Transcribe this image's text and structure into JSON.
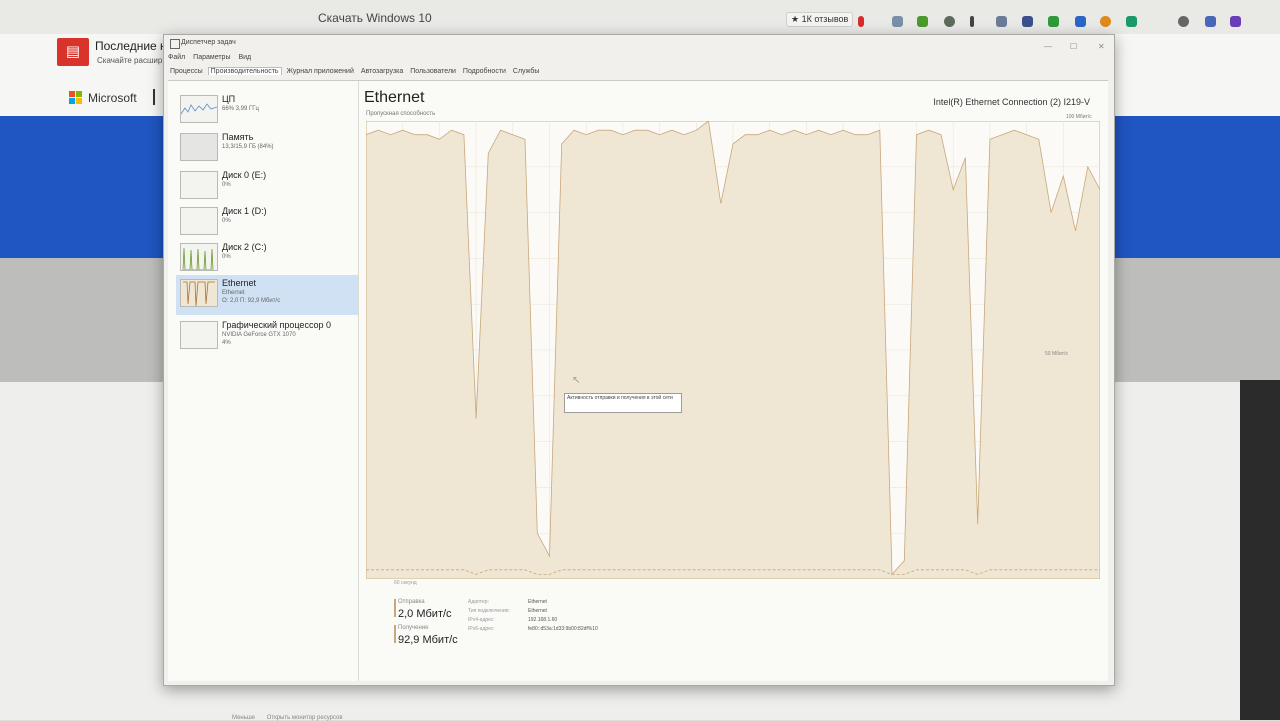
{
  "browser": {
    "title": "Скачать Windows 10",
    "reviews_chip": "★ 1К отзывов",
    "news_title": "Последние н",
    "news_sub": "Скачайте расшир",
    "brand": "Microsoft",
    "extension_icons": [
      "bookmark-red",
      "filter",
      "download-green",
      "circle-gray",
      "pen",
      "cloud",
      "shield",
      "shield-green",
      "share",
      "clock-orange",
      "shield-teal",
      "globe",
      "iq",
      "purple-square"
    ]
  },
  "taskmanager": {
    "title": "Диспетчер задач",
    "menu": [
      "Файл",
      "Параметры",
      "Вид"
    ],
    "tabs": [
      "Процессы",
      "Производительность",
      "Журнал приложений",
      "Автозагрузка",
      "Пользователи",
      "Подробности",
      "Службы"
    ],
    "active_tab": "Производительность",
    "resources": [
      {
        "name": "ЦП",
        "sub": "66% 3,99 ГГц",
        "sub2": ""
      },
      {
        "name": "Память",
        "sub": "13,3/15,9 ГБ (84%)",
        "sub2": ""
      },
      {
        "name": "Диск 0 (E:)",
        "sub": "0%",
        "sub2": ""
      },
      {
        "name": "Диск 1 (D:)",
        "sub": "0%",
        "sub2": ""
      },
      {
        "name": "Диск 2 (C:)",
        "sub": "0%",
        "sub2": ""
      },
      {
        "name": "Ethernet",
        "sub": "Ethernet",
        "sub2": "О: 2,0 П: 92,9 Мбит/с"
      },
      {
        "name": "Графический процессор 0",
        "sub": "NVIDIA GeForce GTX 1070",
        "sub2": "4%"
      }
    ],
    "selected_resource": "Ethernet",
    "main": {
      "title": "Ethernet",
      "adapter": "Intel(R) Ethernet Connection (2) I219-V",
      "chart_label": "Пропускная способность",
      "chart_max": "100 Мбит/с",
      "chart_mid": "50 Мбит/с",
      "time_label": "60 секунд",
      "tooltip": "Активность отправки и получения в этой сети"
    },
    "stats": {
      "send_label": "Отправка",
      "send_value": "2,0 Мбит/с",
      "recv_label": "Получение",
      "recv_value": "92,9 Мбит/с",
      "info": [
        {
          "label": "Адаптер:",
          "value": "Ethernet"
        },
        {
          "label": "Тип подключения:",
          "value": "Ethernet"
        },
        {
          "label": "IPv4-адрес:",
          "value": "192.168.1.60"
        },
        {
          "label": "IPv6-адрес:",
          "value": "fe80::d53a:1d33:9b00:82df%10"
        }
      ]
    },
    "footer": {
      "less": "Меньше",
      "monitor": "Открыть монитор ресурсов"
    },
    "colors": {
      "receive": "#c9a77a",
      "send": "#c9a77a",
      "fill": "#efe6d3",
      "selection": "#cfe1f3"
    }
  },
  "chart_data": {
    "type": "area",
    "title": "",
    "xlabel": "60 секунд",
    "ylabel": "Пропускная способность",
    "ylim": [
      0,
      100
    ],
    "grid": true,
    "x": [
      0,
      1,
      2,
      3,
      4,
      5,
      6,
      7,
      8,
      9,
      10,
      11,
      12,
      13,
      14,
      15,
      16,
      17,
      18,
      19,
      20,
      21,
      22,
      23,
      24,
      25,
      26,
      27,
      28,
      29,
      30,
      31,
      32,
      33,
      34,
      35,
      36,
      37,
      38,
      39,
      40,
      41,
      42,
      43,
      44,
      45,
      46,
      47,
      48,
      49,
      50,
      51,
      52,
      53,
      54,
      55,
      56,
      57,
      58,
      59,
      60
    ],
    "series": [
      {
        "name": "Получение",
        "values": [
          97,
          98,
          97,
          98,
          97,
          97,
          96,
          98,
          97,
          35,
          93,
          98,
          97,
          96,
          10,
          5,
          95,
          98,
          97,
          98,
          98,
          97,
          98,
          98,
          97,
          98,
          97,
          98,
          100,
          82,
          95,
          97,
          97,
          98,
          97,
          98,
          97,
          98,
          97,
          98,
          97,
          97,
          98,
          1,
          4,
          97,
          98,
          97,
          85,
          92,
          12,
          96,
          97,
          98,
          97,
          96,
          80,
          88,
          76,
          90,
          85
        ]
      },
      {
        "name": "Отправка",
        "values": [
          2,
          2,
          2,
          2,
          2,
          2,
          2,
          2,
          2,
          1,
          2,
          2,
          2,
          2,
          1,
          1,
          2,
          2,
          2,
          2,
          2,
          2,
          2,
          2,
          2,
          2,
          2,
          2,
          2,
          2,
          2,
          2,
          2,
          2,
          2,
          2,
          2,
          2,
          2,
          2,
          2,
          2,
          2,
          1,
          1,
          2,
          2,
          2,
          2,
          2,
          1,
          2,
          2,
          2,
          2,
          2,
          2,
          2,
          2,
          2,
          2
        ]
      }
    ]
  }
}
